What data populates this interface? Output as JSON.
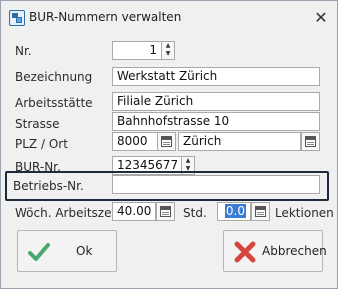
{
  "window": {
    "title": "BUR-Nummern verwalten"
  },
  "form": {
    "nr": {
      "label": "Nr.",
      "value": "1"
    },
    "bezeichnung": {
      "label": "Bezeichnung",
      "value": "Werkstatt Zürich"
    },
    "arbeitsstaette": {
      "label": "Arbeitsstätte",
      "value": "Filiale Zürich"
    },
    "strasse": {
      "label": "Strasse",
      "value": "Bahnhofstrasse 10"
    },
    "plz_ort": {
      "label": "PLZ / Ort",
      "plz": "8000",
      "ort": "Zürich"
    },
    "bur_nr": {
      "label": "BUR-Nr.",
      "value": "12345677"
    },
    "betriebs_nr": {
      "label": "Betriebs-Nr.",
      "value": ""
    },
    "arbeitszeit": {
      "label": "Wöch. Arbeitszeit",
      "value": "40.00",
      "unit": "Std."
    },
    "lektionen": {
      "value": "0.0",
      "unit": "Lektionen"
    }
  },
  "buttons": {
    "ok": "Ok",
    "cancel": "Abbrechen"
  },
  "colors": {
    "ok_icon": "#4aa86e",
    "cancel_icon": "#d64541",
    "focus_border": "#1f2a3c",
    "selection": "#3a7bd5"
  },
  "icons": {
    "app": "bur-app-icon",
    "close": "close-icon",
    "calendar": "calendar-icon",
    "ok": "checkmark-icon",
    "cancel": "x-icon"
  }
}
